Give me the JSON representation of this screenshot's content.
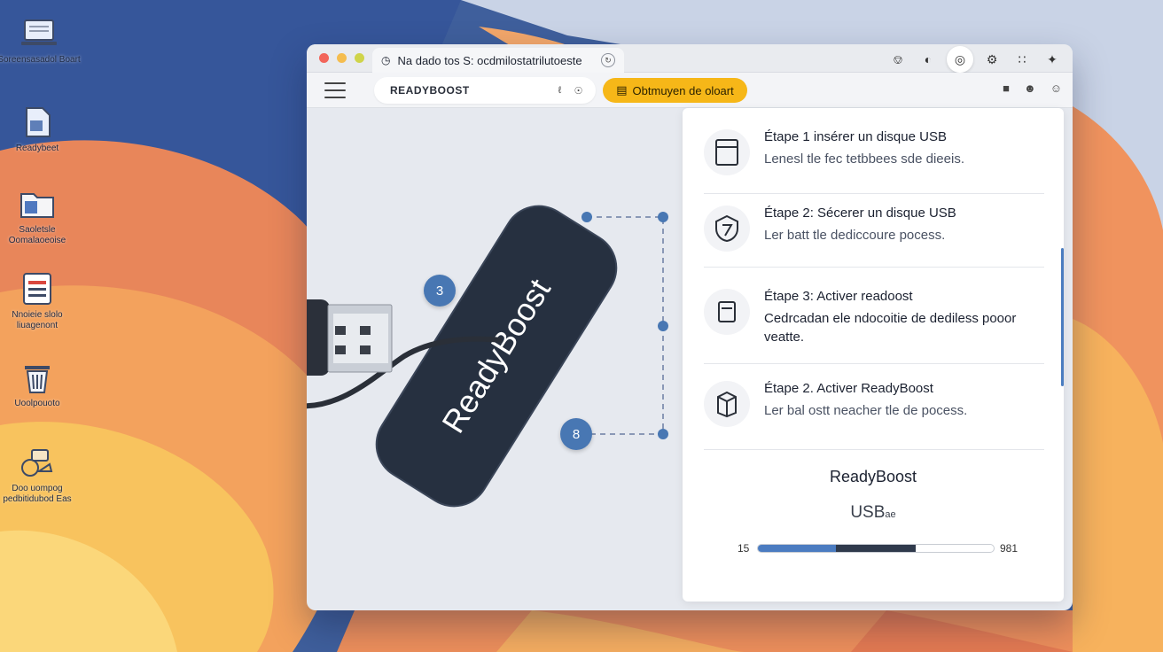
{
  "window": {
    "tab_title": "Na dado tos S: ocdmilostatrilutoeste",
    "address": "READYBOOST",
    "promo_label": "Obtmuyen de oloart"
  },
  "desktop": {
    "icons": [
      {
        "label": "Soreensasadol Boart",
        "icon": "laptop-icon"
      },
      {
        "label": "Readybeet",
        "icon": "document-icon"
      },
      {
        "label": "Saoletsle Oomalaoeoise",
        "icon": "folder-icon"
      },
      {
        "label": "Nnoieie slolo liuagenont",
        "icon": "list-icon"
      },
      {
        "label": "Uoolpouoto",
        "icon": "trash-icon"
      },
      {
        "label": "Doo uompog pedbitidubod Eas",
        "icon": "tools-icon"
      }
    ]
  },
  "stage": {
    "device_label": "ReadyBoost",
    "badge_top": "3",
    "badge_bottom": "8"
  },
  "steps": [
    {
      "title": "Étape 1 insérer un disque USB",
      "desc": "Lenesl tle fec tetbbees sde dieeis.",
      "icon": "drive-icon"
    },
    {
      "title": "Étape 2: Sécerer un disque USB",
      "desc": "Ler batt tle dediccoure pocess.",
      "icon": "shield-icon"
    },
    {
      "title": "Étape 3: Activer readoost",
      "desc": "Cedrcadan ele ndocoitie de dediless pooor veatte.",
      "icon": "save-icon"
    },
    {
      "title": "Étape 2. Activer ReadyBoost",
      "desc": "Ler bal ostt neacher tle de pocess.",
      "icon": "box-icon"
    }
  ],
  "readyboost": {
    "title": "ReadyBoost",
    "usb_label": "USB",
    "usb_suffix": "ae",
    "slider_min": "15",
    "slider_max": "981",
    "primary_fraction": 0.33,
    "secondary_fraction": 0.67
  },
  "colors": {
    "accent": "#4877b3",
    "promo": "#f6b718",
    "device": "#2b3240"
  }
}
